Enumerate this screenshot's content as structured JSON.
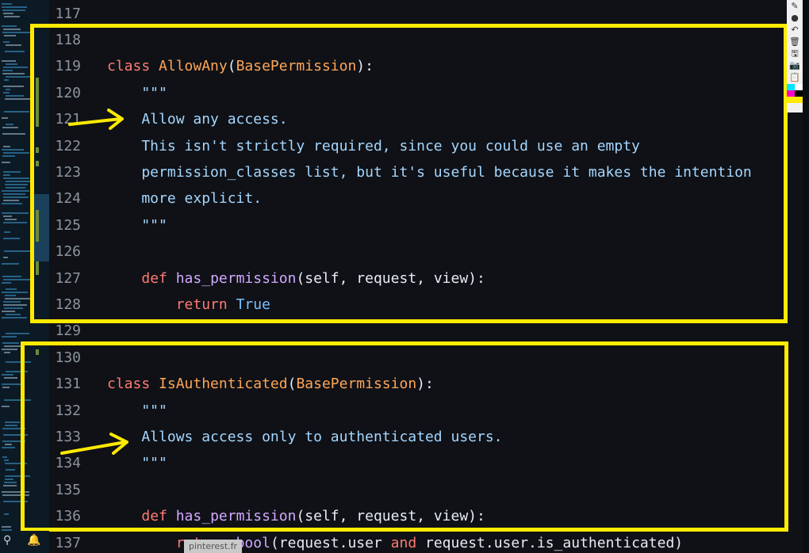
{
  "editor": {
    "lines": [
      {
        "num": "117",
        "tokens": []
      },
      {
        "num": "118",
        "tokens": []
      },
      {
        "num": "119",
        "tokens": [
          {
            "t": "class",
            "c": "kw"
          },
          {
            "t": " ",
            "c": "plain"
          },
          {
            "t": "AllowAny",
            "c": "cls"
          },
          {
            "t": "(",
            "c": "plain"
          },
          {
            "t": "BasePermission",
            "c": "cls"
          },
          {
            "t": "):",
            "c": "plain"
          }
        ]
      },
      {
        "num": "120",
        "tokens": [
          {
            "t": "    \"\"\"",
            "c": "str"
          }
        ]
      },
      {
        "num": "121",
        "tokens": [
          {
            "t": "    Allow any access.",
            "c": "str"
          }
        ]
      },
      {
        "num": "122",
        "tokens": [
          {
            "t": "    This isn't strictly required, since you could use an empty",
            "c": "str"
          }
        ]
      },
      {
        "num": "123",
        "tokens": [
          {
            "t": "    permission_classes list, but it's useful because it makes the intention",
            "c": "str"
          }
        ]
      },
      {
        "num": "124",
        "tokens": [
          {
            "t": "    more explicit.",
            "c": "str"
          }
        ]
      },
      {
        "num": "125",
        "tokens": [
          {
            "t": "    \"\"\"",
            "c": "str"
          }
        ]
      },
      {
        "num": "126",
        "tokens": []
      },
      {
        "num": "127",
        "tokens": [
          {
            "t": "    ",
            "c": "plain"
          },
          {
            "t": "def",
            "c": "kw"
          },
          {
            "t": " ",
            "c": "plain"
          },
          {
            "t": "has_permission",
            "c": "fn"
          },
          {
            "t": "(self, request, view):",
            "c": "plain"
          }
        ]
      },
      {
        "num": "128",
        "tokens": [
          {
            "t": "        ",
            "c": "plain"
          },
          {
            "t": "return",
            "c": "kw"
          },
          {
            "t": " ",
            "c": "plain"
          },
          {
            "t": "True",
            "c": "const"
          }
        ]
      },
      {
        "num": "129",
        "tokens": []
      },
      {
        "num": "130",
        "tokens": []
      },
      {
        "num": "131",
        "tokens": [
          {
            "t": "class",
            "c": "kw"
          },
          {
            "t": " ",
            "c": "plain"
          },
          {
            "t": "IsAuthenticated",
            "c": "cls"
          },
          {
            "t": "(",
            "c": "plain"
          },
          {
            "t": "BasePermission",
            "c": "cls"
          },
          {
            "t": "):",
            "c": "plain"
          }
        ]
      },
      {
        "num": "132",
        "tokens": [
          {
            "t": "    \"\"\"",
            "c": "str"
          }
        ]
      },
      {
        "num": "133",
        "tokens": [
          {
            "t": "    Allows access only to authenticated users.",
            "c": "str"
          }
        ]
      },
      {
        "num": "134",
        "tokens": [
          {
            "t": "    \"\"\"",
            "c": "str"
          }
        ]
      },
      {
        "num": "135",
        "tokens": []
      },
      {
        "num": "136",
        "tokens": [
          {
            "t": "    ",
            "c": "plain"
          },
          {
            "t": "def",
            "c": "kw"
          },
          {
            "t": " ",
            "c": "plain"
          },
          {
            "t": "has_permission",
            "c": "fn"
          },
          {
            "t": "(self, request, view):",
            "c": "plain"
          }
        ]
      },
      {
        "num": "137",
        "tokens": [
          {
            "t": "        ",
            "c": "plain"
          },
          {
            "t": "return",
            "c": "kw"
          },
          {
            "t": " ",
            "c": "plain"
          },
          {
            "t": "bool",
            "c": "fn"
          },
          {
            "t": "(request.user ",
            "c": "plain"
          },
          {
            "t": "and",
            "c": "kw"
          },
          {
            "t": " request.user.is_authenticated)",
            "c": "plain"
          }
        ]
      }
    ]
  },
  "annotations": {
    "highlight_color": "#ffea00"
  },
  "toolbar": {
    "icons": [
      "pen-icon",
      "dot-icon",
      "undo-icon",
      "trash-icon",
      "save-icon",
      "screenshot-icon",
      "clipboard-icon"
    ],
    "swatch_colors": [
      "#00e5ff",
      "#ffffff",
      "#ff00c8",
      "#000000",
      "#ffea00",
      "#ffea00"
    ]
  },
  "overlay_tag": "pinterest.fr"
}
